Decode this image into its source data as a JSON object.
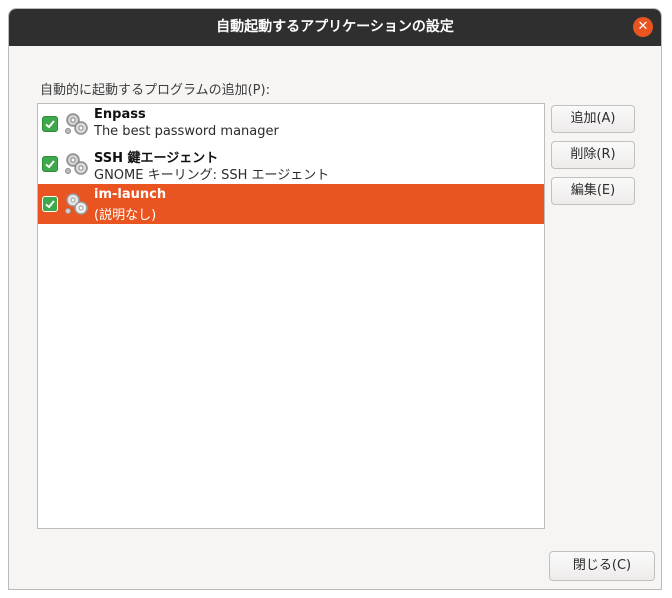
{
  "window": {
    "title": "自動起動するアプリケーションの設定"
  },
  "list_label": "自動的に起動するプログラムの追加(P):",
  "programs": [
    {
      "name": "Enpass",
      "description": "The best password manager",
      "enabled": true,
      "selected": false
    },
    {
      "name": "SSH 鍵エージェント",
      "description": "GNOME キーリング: SSH エージェント",
      "enabled": true,
      "selected": false
    },
    {
      "name": "im-launch",
      "description": "(説明なし)",
      "enabled": true,
      "selected": true
    }
  ],
  "buttons": {
    "add": "追加(A)",
    "remove": "削除(R)",
    "edit": "編集(E)",
    "close": "閉じる(C)"
  },
  "colors": {
    "accent": "#e95420",
    "check": "#3ea94a",
    "titlebar": "#2f2f2f"
  },
  "icons": {
    "close": "close-icon",
    "program": "gears-icon",
    "check": "checkbox-checked-icon"
  }
}
